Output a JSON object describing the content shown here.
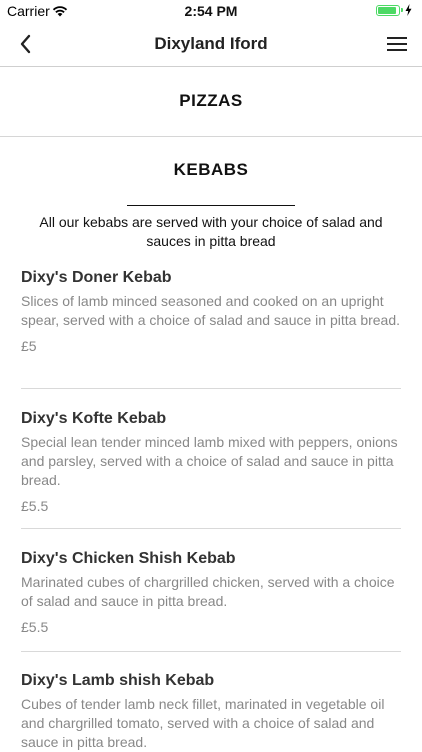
{
  "status_bar": {
    "carrier": "Carrier",
    "time": "2:54 PM",
    "battery_level": 0.9
  },
  "nav": {
    "title": "Dixyland Iford",
    "back_icon": "chevron-left-icon",
    "menu_icon": "hamburger-menu-icon"
  },
  "sections": {
    "pizzas_title": "PIZZAS",
    "kebabs_title": "KEBABS",
    "kebabs_description": "All our kebabs are served with your choice of salad and sauces in pitta bread"
  },
  "items": [
    {
      "name": "Dixy's Doner Kebab",
      "description": "Slices of lamb minced seasoned and cooked on an upright spear, served with a choice of salad and sauce in pitta bread.",
      "price": "£5"
    },
    {
      "name": "Dixy's Kofte Kebab",
      "description": "Special lean tender minced lamb mixed with peppers, onions and parsley, served with a choice of salad and sauce in pitta bread.",
      "price": "£5.5"
    },
    {
      "name": "Dixy's Chicken Shish Kebab",
      "description": "Marinated cubes of chargrilled chicken, served with a choice of salad and sauce in pitta bread.",
      "price": "£5.5"
    },
    {
      "name": "Dixy's Lamb shish Kebab",
      "description": "Cubes of tender lamb neck fillet, marinated in vegetable oil and chargrilled tomato, served with a choice of salad and sauce in pitta bread.",
      "price": ""
    }
  ]
}
